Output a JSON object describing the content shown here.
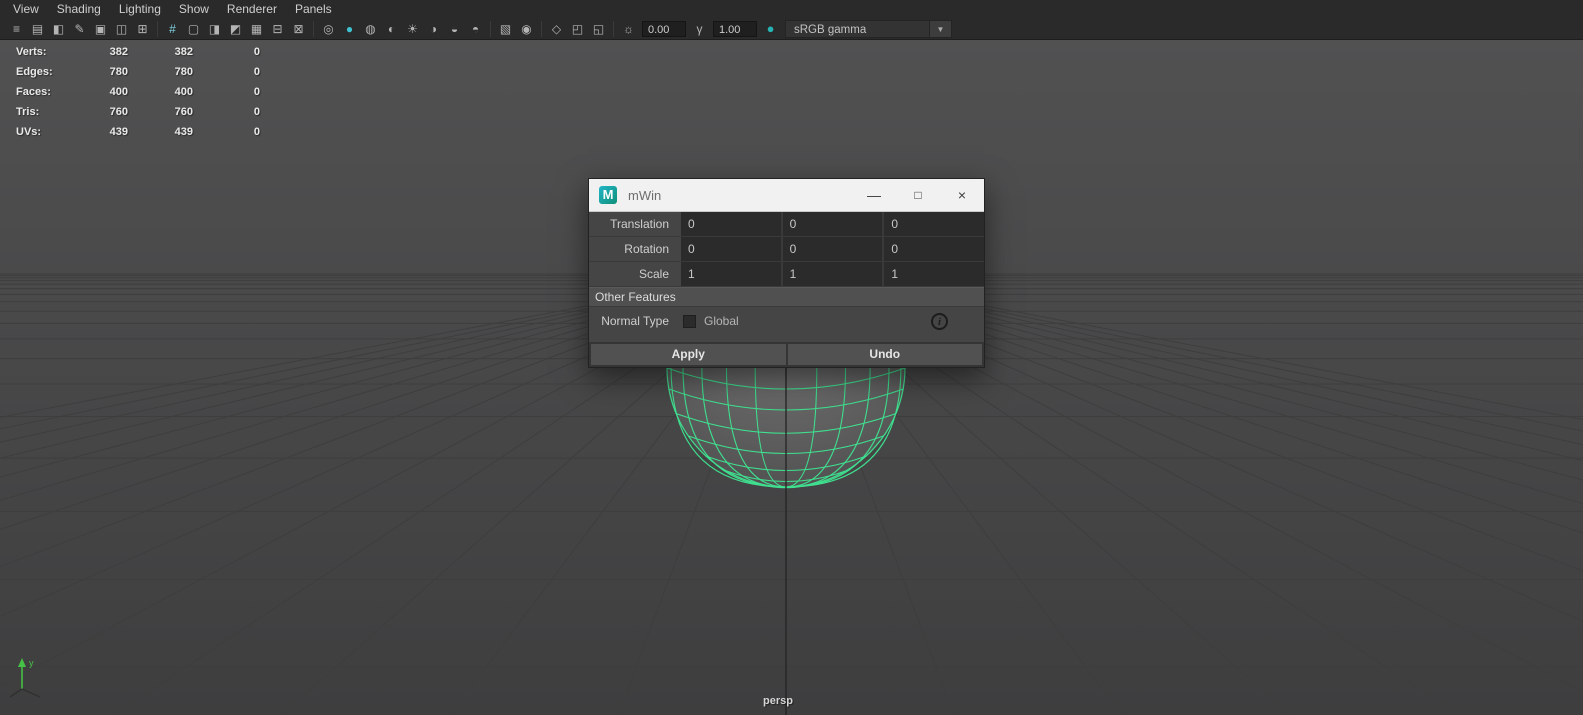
{
  "colors": {
    "wireframe_green": "#3fe08f",
    "maya_teal": "#1ba8a8",
    "viewport_bg": "#4a4a4b",
    "titlebar_bg": "#f1f1f1"
  },
  "menu_bar": {
    "items": [
      "View",
      "Shading",
      "Lighting",
      "Show",
      "Renderer",
      "Panels"
    ]
  },
  "toolbar": {
    "icons": [
      {
        "name": "panel-menu-icon",
        "glyph": "≡"
      },
      {
        "name": "camera-select-icon",
        "glyph": "▤"
      },
      {
        "name": "camera-lock-icon",
        "glyph": "◧"
      },
      {
        "name": "camera-attributes-icon",
        "glyph": "✎"
      },
      {
        "name": "bookmarks-icon",
        "glyph": "▣"
      },
      {
        "name": "image-plane-icon",
        "glyph": "◫"
      },
      {
        "name": "pan-zoom-icon",
        "glyph": "⊞"
      },
      {
        "sep": true
      },
      {
        "name": "grid-icon",
        "glyph": "#",
        "color": "#7fd3e0"
      },
      {
        "name": "film-gate-icon",
        "glyph": "▢"
      },
      {
        "name": "resolution-gate-icon",
        "glyph": "◨"
      },
      {
        "name": "gate-mask-icon",
        "glyph": "◩"
      },
      {
        "name": "field-chart-icon",
        "glyph": "▦"
      },
      {
        "name": "safe-action-icon",
        "glyph": "⊟"
      },
      {
        "name": "safe-title-icon",
        "glyph": "⊠"
      },
      {
        "sep": true
      },
      {
        "name": "wireframe-icon",
        "glyph": "◎"
      },
      {
        "name": "smooth-shade-icon",
        "glyph": "●",
        "color": "#3fc1d1"
      },
      {
        "name": "bounding-box-icon",
        "glyph": "◍"
      },
      {
        "name": "textured-icon",
        "glyph": "◐"
      },
      {
        "name": "use-all-lights-icon",
        "glyph": "☀"
      },
      {
        "name": "shadows-icon",
        "glyph": "◑"
      },
      {
        "name": "screen-space-ao-icon",
        "glyph": "◒"
      },
      {
        "name": "motion-blur-icon",
        "glyph": "◓"
      },
      {
        "sep": true
      },
      {
        "name": "xray-icon",
        "glyph": "▧"
      },
      {
        "name": "wireframe-on-shaded-icon",
        "glyph": "◉"
      },
      {
        "sep": true
      },
      {
        "name": "isolate-select-icon",
        "glyph": "◇"
      },
      {
        "name": "snapshot-icon",
        "glyph": "◰"
      },
      {
        "name": "scene-render-icon",
        "glyph": "◱"
      },
      {
        "sep": true
      }
    ],
    "exposure_icon": "☼",
    "exposure_value": "0.00",
    "gamma_icon": "γ",
    "gamma_value": "1.00",
    "color_management_icon": "●",
    "view_transform": "sRGB gamma",
    "dropdown_arrow": "▼"
  },
  "hud": {
    "rows": [
      {
        "label": "Verts:",
        "v1": "382",
        "v2": "382",
        "v3": "0"
      },
      {
        "label": "Edges:",
        "v1": "780",
        "v2": "780",
        "v3": "0"
      },
      {
        "label": "Faces:",
        "v1": "400",
        "v2": "400",
        "v3": "0"
      },
      {
        "label": "Tris:",
        "v1": "760",
        "v2": "760",
        "v3": "0"
      },
      {
        "label": "UVs:",
        "v1": "439",
        "v2": "439",
        "v3": "0"
      }
    ]
  },
  "viewport": {
    "camera_label": "persp",
    "axis_y_label": "y"
  },
  "dialog": {
    "title": "mWin",
    "logo_glyph": "M",
    "window_buttons": {
      "minimize": "—",
      "maximize": "□",
      "close": "×"
    },
    "transform_rows": [
      {
        "label": "Translation",
        "x": "0",
        "y": "0",
        "z": "0"
      },
      {
        "label": "Rotation",
        "x": "0",
        "y": "0",
        "z": "0"
      },
      {
        "label": "Scale",
        "x": "1",
        "y": "1",
        "z": "1"
      }
    ],
    "section_header": "Other Features",
    "normal_type": {
      "label": "Normal Type",
      "value": "Global",
      "checked": false
    },
    "info_icon": "i",
    "buttons": {
      "apply": "Apply",
      "undo": "Undo"
    }
  }
}
